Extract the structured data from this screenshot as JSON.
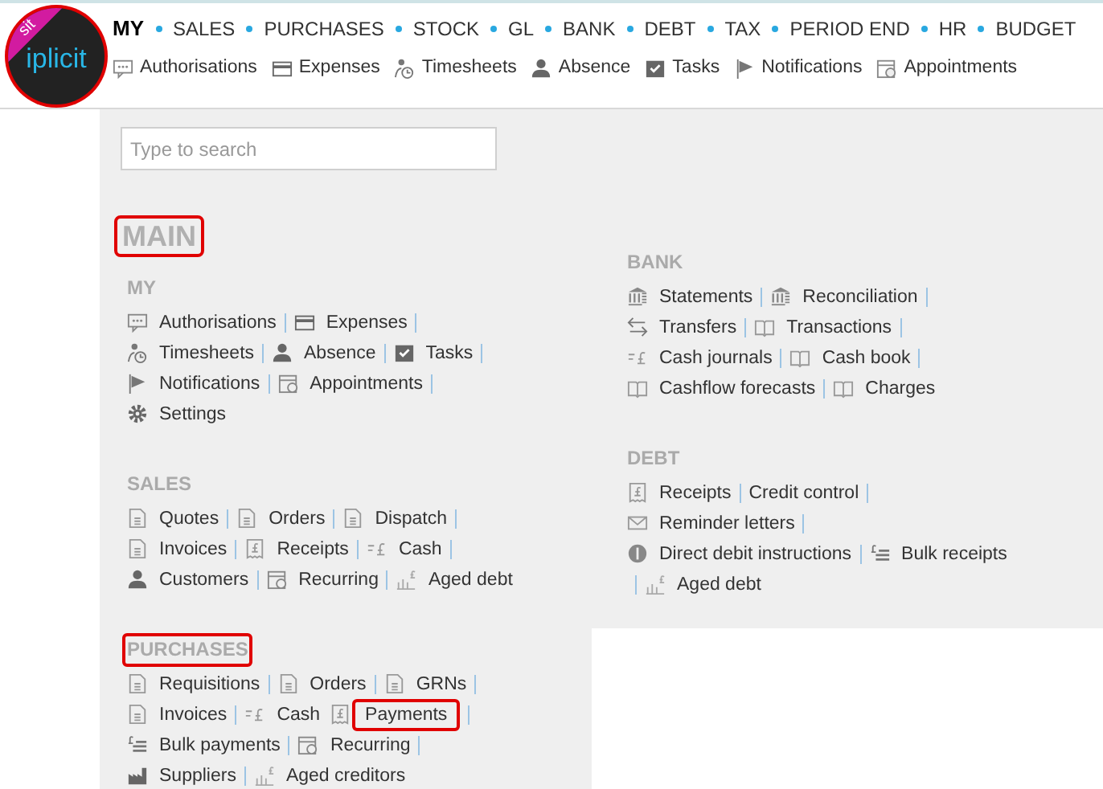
{
  "logo": {
    "ribbon": "sit",
    "wordmark": "iplicit",
    "highlighted": true
  },
  "top_nav": [
    {
      "label": "MY",
      "selected": true
    },
    {
      "label": "SALES",
      "selected": false
    },
    {
      "label": "PURCHASES",
      "selected": false
    },
    {
      "label": "STOCK",
      "selected": false
    },
    {
      "label": "GL",
      "selected": false
    },
    {
      "label": "BANK",
      "selected": false
    },
    {
      "label": "DEBT",
      "selected": false
    },
    {
      "label": "TAX",
      "selected": false
    },
    {
      "label": "PERIOD END",
      "selected": false
    },
    {
      "label": "HR",
      "selected": false
    },
    {
      "label": "BUDGET",
      "selected": false
    }
  ],
  "sub_nav": [
    {
      "label": "Authorisations",
      "kind": "chat"
    },
    {
      "label": "Expenses",
      "kind": "card"
    },
    {
      "label": "Timesheets",
      "kind": "timesheet"
    },
    {
      "label": "Absence",
      "kind": "person"
    },
    {
      "label": "Tasks",
      "kind": "check"
    },
    {
      "label": "Notifications",
      "kind": "flag"
    },
    {
      "label": "Appointments",
      "kind": "calendar"
    }
  ],
  "search": {
    "placeholder": "Type to search"
  },
  "heading": {
    "text": "MAIN",
    "highlighted": true
  },
  "columns": [
    [
      {
        "title": "MY",
        "highlighted": false,
        "rows": [
          {
            "items": [
              {
                "label": "Authorisations",
                "kind": "chat",
                "highlighted": false,
                "separator": true
              },
              {
                "label": "Expenses",
                "kind": "card",
                "highlighted": false,
                "separator": true
              }
            ]
          },
          {
            "items": [
              {
                "label": "Timesheets",
                "kind": "timesheet",
                "highlighted": false,
                "separator": true
              },
              {
                "label": "Absence",
                "kind": "person",
                "highlighted": false,
                "separator": true
              },
              {
                "label": "Tasks",
                "kind": "check",
                "highlighted": false,
                "separator": true
              }
            ]
          },
          {
            "items": [
              {
                "label": "Notifications",
                "kind": "flag",
                "highlighted": false,
                "separator": true
              },
              {
                "label": "Appointments",
                "kind": "calendar",
                "highlighted": false,
                "separator": true
              }
            ]
          },
          {
            "items": [
              {
                "label": "Settings",
                "kind": "gear",
                "highlighted": false,
                "separator": false
              }
            ]
          }
        ]
      },
      {
        "title": "SALES",
        "highlighted": false,
        "rows": [
          {
            "items": [
              {
                "label": "Quotes",
                "kind": "document",
                "highlighted": false,
                "separator": true
              },
              {
                "label": "Orders",
                "kind": "document",
                "highlighted": false,
                "separator": true
              },
              {
                "label": "Dispatch",
                "kind": "document",
                "highlighted": false,
                "separator": true
              }
            ]
          },
          {
            "items": [
              {
                "label": "Invoices",
                "kind": "document",
                "highlighted": false,
                "separator": true
              },
              {
                "label": "Receipts",
                "kind": "receipt",
                "highlighted": false,
                "separator": true
              },
              {
                "label": "Cash",
                "kind": "cash",
                "highlighted": false,
                "separator": true
              }
            ]
          },
          {
            "items": [
              {
                "label": "Customers",
                "kind": "person",
                "highlighted": false,
                "separator": true
              },
              {
                "label": "Recurring",
                "kind": "calendar",
                "highlighted": false,
                "separator": true
              },
              {
                "label": "Aged debt",
                "kind": "chart",
                "highlighted": false,
                "separator": false
              }
            ]
          }
        ]
      },
      {
        "title": "PURCHASES",
        "highlighted": true,
        "rows": [
          {
            "items": [
              {
                "label": "Requisitions",
                "kind": "document",
                "highlighted": false,
                "separator": true
              },
              {
                "label": "Orders",
                "kind": "document",
                "highlighted": false,
                "separator": true
              },
              {
                "label": "GRNs",
                "kind": "document",
                "highlighted": false,
                "separator": true
              }
            ]
          },
          {
            "items": [
              {
                "label": "Invoices",
                "kind": "document",
                "highlighted": false,
                "separator": true
              },
              {
                "label": "Cash",
                "kind": "cash",
                "highlighted": false,
                "separator": false
              },
              {
                "label": "Payments",
                "kind": "receipt",
                "highlighted": true,
                "separator": true
              }
            ]
          },
          {
            "items": [
              {
                "label": "Bulk payments",
                "kind": "bulk",
                "highlighted": false,
                "separator": true
              },
              {
                "label": "Recurring",
                "kind": "calendar",
                "highlighted": false,
                "separator": true
              }
            ]
          },
          {
            "items": [
              {
                "label": "Suppliers",
                "kind": "factory",
                "highlighted": false,
                "separator": true
              },
              {
                "label": "Aged creditors",
                "kind": "chart",
                "highlighted": false,
                "separator": false
              }
            ]
          }
        ]
      }
    ],
    [
      {
        "title": "BANK",
        "highlighted": false,
        "rows": [
          {
            "items": [
              {
                "label": "Statements",
                "kind": "bank",
                "highlighted": false,
                "separator": true
              },
              {
                "label": "Reconciliation",
                "kind": "bank",
                "highlighted": false,
                "separator": true
              }
            ]
          },
          {
            "items": [
              {
                "label": "Transfers",
                "kind": "transfer",
                "highlighted": false,
                "separator": true
              },
              {
                "label": "Transactions",
                "kind": "book",
                "highlighted": false,
                "separator": true
              }
            ]
          },
          {
            "items": [
              {
                "label": "Cash journals",
                "kind": "cash",
                "highlighted": false,
                "separator": true
              },
              {
                "label": "Cash book",
                "kind": "book",
                "highlighted": false,
                "separator": true
              }
            ]
          },
          {
            "items": [
              {
                "label": "Cashflow forecasts",
                "kind": "book",
                "highlighted": false,
                "separator": true
              },
              {
                "label": "Charges",
                "kind": "book",
                "highlighted": false,
                "separator": false
              }
            ]
          }
        ]
      },
      {
        "title": "DEBT",
        "highlighted": false,
        "rows": [
          {
            "items": [
              {
                "label": "Receipts",
                "kind": "receipt",
                "highlighted": false,
                "separator": true
              },
              {
                "label": "Credit control",
                "kind": "none",
                "highlighted": false,
                "separator": true
              }
            ]
          },
          {
            "items": [
              {
                "label": "Reminder letters",
                "kind": "mail",
                "highlighted": false,
                "separator": true
              }
            ]
          },
          {
            "items": [
              {
                "label": "Direct debit instructions",
                "kind": "disc",
                "highlighted": false,
                "separator": true
              },
              {
                "label": "Bulk receipts",
                "kind": "bulk",
                "highlighted": false,
                "separator": false
              }
            ]
          },
          {
            "leading_bar": true,
            "items": [
              {
                "label": "Aged debt",
                "kind": "chart",
                "highlighted": false,
                "separator": false
              }
            ]
          }
        ]
      }
    ]
  ]
}
